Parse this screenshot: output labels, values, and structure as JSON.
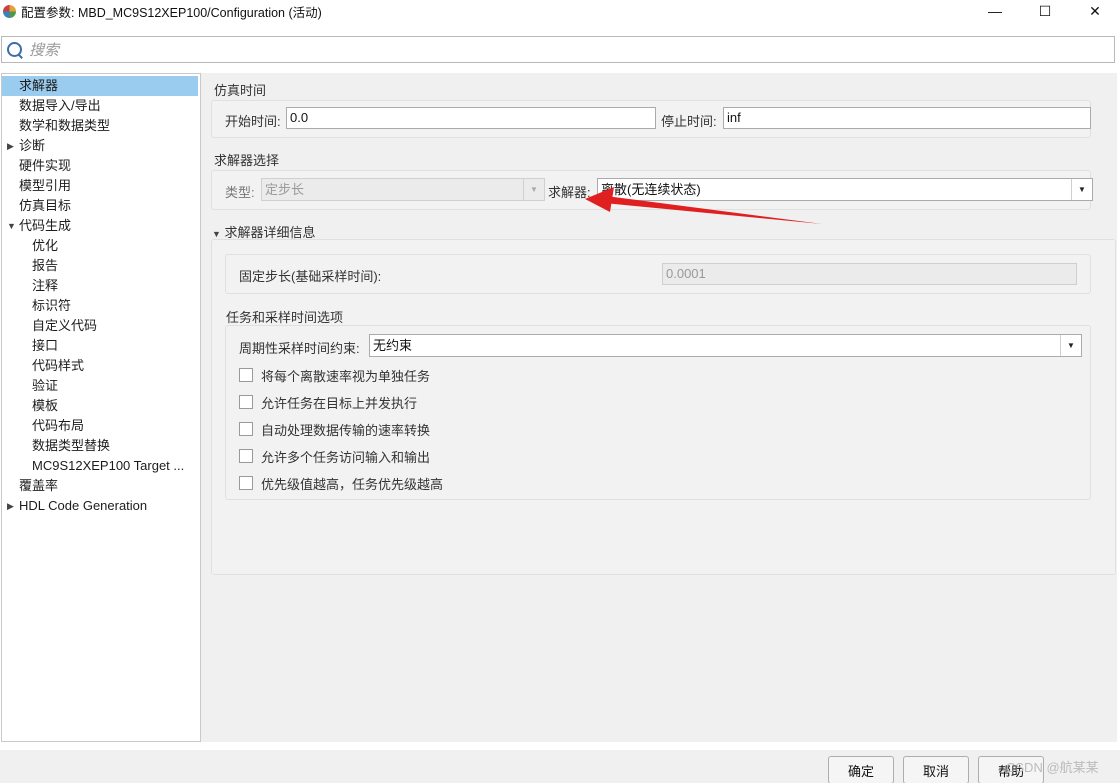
{
  "window": {
    "title": "配置参数: MBD_MC9S12XEP100/Configuration (活动)",
    "minimize": "—",
    "maximize": "☐",
    "close": "✕"
  },
  "search": {
    "placeholder": "搜索"
  },
  "tree": {
    "items": [
      {
        "label": "求解器",
        "level": 0,
        "selected": true
      },
      {
        "label": "数据导入/导出",
        "level": 0
      },
      {
        "label": "数学和数据类型",
        "level": 0
      },
      {
        "label": "诊断",
        "level": 0,
        "expander": "▶"
      },
      {
        "label": "硬件实现",
        "level": 0
      },
      {
        "label": "模型引用",
        "level": 0
      },
      {
        "label": "仿真目标",
        "level": 0
      },
      {
        "label": "代码生成",
        "level": 0,
        "expander": "▼"
      },
      {
        "label": "优化",
        "level": 1
      },
      {
        "label": "报告",
        "level": 1
      },
      {
        "label": "注释",
        "level": 1
      },
      {
        "label": "标识符",
        "level": 1
      },
      {
        "label": "自定义代码",
        "level": 1
      },
      {
        "label": "接口",
        "level": 1
      },
      {
        "label": "代码样式",
        "level": 1
      },
      {
        "label": "验证",
        "level": 1
      },
      {
        "label": "模板",
        "level": 1
      },
      {
        "label": "代码布局",
        "level": 1
      },
      {
        "label": "数据类型替换",
        "level": 1
      },
      {
        "label": "MC9S12XEP100 Target ...",
        "level": 1
      },
      {
        "label": "覆盖率",
        "level": 0
      },
      {
        "label": "HDL Code Generation",
        "level": 0,
        "expander": "▶"
      }
    ]
  },
  "sim_time": {
    "title": "仿真时间",
    "start_label": "开始时间:",
    "start_value": "0.0",
    "stop_label": "停止时间:",
    "stop_value": "inf"
  },
  "solver_select": {
    "title": "求解器选择",
    "type_label": "类型:",
    "type_value": "定步长",
    "solver_label": "求解器:",
    "solver_value": "离散(无连续状态)"
  },
  "solver_details": {
    "title": "求解器详细信息",
    "expander": "▼",
    "fixed_step_label": "固定步长(基础采样时间):",
    "fixed_step_value": "0.0001"
  },
  "tasking": {
    "title": "任务和采样时间选项",
    "constraint_label": "周期性采样时间约束:",
    "constraint_value": "无约束",
    "checkboxes": [
      {
        "label": "将每个离散速率视为单独任务",
        "checked": false
      },
      {
        "label": "允许任务在目标上并发执行",
        "checked": false
      },
      {
        "label": "自动处理数据传输的速率转换",
        "checked": false
      },
      {
        "label": "允许多个任务访问输入和输出",
        "checked": false
      },
      {
        "label": "优先级值越高，任务优先级越高",
        "checked": false
      }
    ]
  },
  "buttons": {
    "ok": "确定",
    "cancel": "取消",
    "help": "帮助"
  },
  "watermark": "CSDN @航某某",
  "colors": {
    "selection": "#99ccee",
    "annotation_arrow": "#e02020"
  },
  "icons": [
    "app-icon",
    "search-icon",
    "dropdown-arrow-icon",
    "tree-expander-icon"
  ]
}
